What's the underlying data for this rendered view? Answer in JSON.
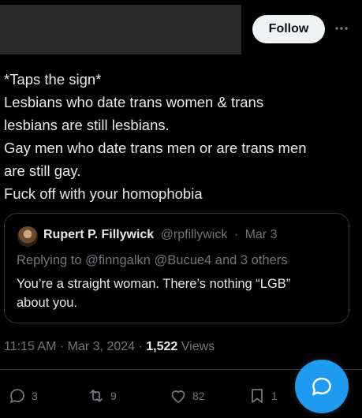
{
  "header": {
    "follow_label": "Follow"
  },
  "tweet": {
    "lines": [
      "*Taps the sign*",
      "Lesbians who date trans women & trans",
      "lesbians are still lesbians.",
      "Gay men who date trans men or are trans men",
      "are still gay.",
      "Fuck off with your homophobia"
    ],
    "time": "11:15 AM",
    "date": "Mar 3, 2024",
    "views_count": "1,522",
    "views_label": "Views"
  },
  "quote": {
    "name": "Rupert P. Fillywick",
    "handle": "@rpfillywick",
    "date": "Mar 3",
    "reply_to": "Replying to @finngalkn @Bucue4 and 3 others",
    "body_lines": [
      "You’re a straight woman. There’s nothing “LGB”",
      "about you."
    ]
  },
  "actions": {
    "replies": "3",
    "reposts": "9",
    "likes": "82",
    "bookmarks": "1"
  },
  "colors": {
    "background": "#000000",
    "text": "#e7e9ea",
    "muted": "#71767b",
    "accent": "#1d9bf0"
  }
}
